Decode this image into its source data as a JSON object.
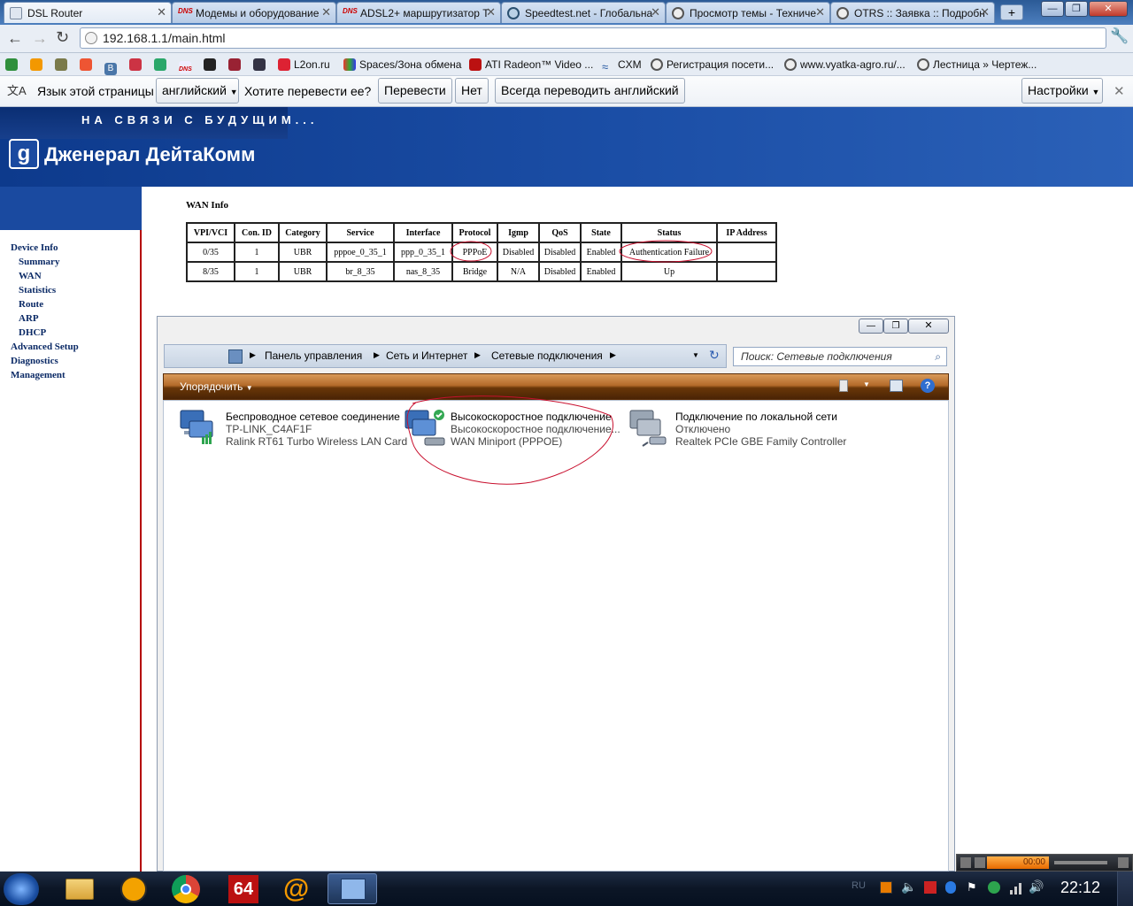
{
  "browser": {
    "tabs": [
      {
        "label": "DSL Router",
        "active": true
      },
      {
        "label": "Модемы и оборудование"
      },
      {
        "label": "ADSL2+ маршрутизатор Т"
      },
      {
        "label": "Speedtest.net - Глобальна"
      },
      {
        "label": "Просмотр темы - Техниче"
      },
      {
        "label": "OTRS :: Заявка :: Подробн"
      }
    ],
    "new_tab_label": "+",
    "url": "192.168.1.1/main.html",
    "bookmarks": [
      "L2on.ru",
      "Spaces/Зона обмена",
      "ATI Radeon™ Video ...",
      "CXM",
      "Регистрация посети...",
      "www.vyatka-agro.ru/...",
      "Лестница » Чертеж..."
    ],
    "translate": {
      "prompt_prefix": "Язык этой страницы",
      "language": "английский",
      "question": "Хотите перевести ее?",
      "translate_btn": "Перевести",
      "no_btn": "Нет",
      "always_btn": "Всегда переводить английский",
      "settings_btn": "Настройки"
    }
  },
  "router": {
    "slogan": "НА СВЯЗИ С БУДУЩИМ...",
    "brand": "Дженерал ДейтаКомм",
    "nav": [
      {
        "label": "Device Info",
        "level": 0
      },
      {
        "label": "Summary",
        "level": 1
      },
      {
        "label": "WAN",
        "level": 1
      },
      {
        "label": "Statistics",
        "level": 1
      },
      {
        "label": "Route",
        "level": 1
      },
      {
        "label": "ARP",
        "level": 1
      },
      {
        "label": "DHCP",
        "level": 1
      },
      {
        "label": "Advanced Setup",
        "level": 0
      },
      {
        "label": "Diagnostics",
        "level": 0
      },
      {
        "label": "Management",
        "level": 0
      }
    ],
    "section_title": "WAN Info",
    "columns": [
      "VPI/VCI",
      "Con. ID",
      "Category",
      "Service",
      "Interface",
      "Protocol",
      "Igmp",
      "QoS",
      "State",
      "Status",
      "IP Address"
    ],
    "rows": [
      [
        "0/35",
        "1",
        "UBR",
        "pppoe_0_35_1",
        "ppp_0_35_1",
        "PPPoE",
        "Disabled",
        "Disabled",
        "Enabled",
        "Authentication Failure",
        ""
      ],
      [
        "8/35",
        "1",
        "UBR",
        "br_8_35",
        "nas_8_35",
        "Bridge",
        "N/A",
        "Disabled",
        "Enabled",
        "Up",
        ""
      ]
    ]
  },
  "explorer": {
    "breadcrumb": [
      "Панель управления",
      "Сеть и Интернет",
      "Сетевые подключения"
    ],
    "search_placeholder": "Поиск: Сетевые подключения",
    "organize_label": "Упорядочить",
    "connections": [
      {
        "name": "Беспроводное сетевое соединение",
        "status": "TP-LINK_C4AF1F",
        "device": "Ralink RT61 Turbo Wireless LAN Card"
      },
      {
        "name": "Высокоскоростное подключение",
        "status": "Высокоскоростное подключение...",
        "device": "WAN Miniport (PPPOE)"
      },
      {
        "name": "Подключение по локальной сети",
        "status": "Отключено",
        "device": "Realtek PCIe GBE Family Controller"
      }
    ]
  },
  "taskbar": {
    "lang": "RU",
    "clock": "22:12",
    "media_time": "00:00"
  },
  "colors": {
    "annotation": "#c8102e",
    "banner": "#1b4ea6",
    "nav_border": "#b40000"
  }
}
